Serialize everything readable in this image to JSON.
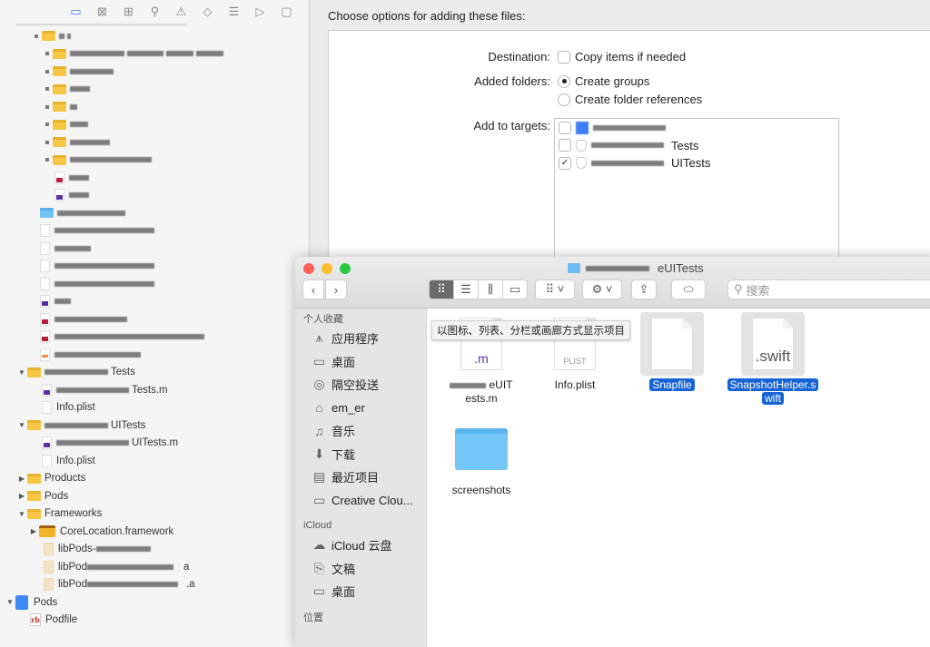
{
  "navigator": {
    "toolbar_icons": [
      "folder-icon",
      "source-control-icon",
      "hierarchy-icon",
      "search-icon",
      "warning-icon",
      "breakpoint-diamond-icon",
      "report-list-icon",
      "tag-icon",
      "comment-icon"
    ],
    "items": [
      {
        "label": "■ ■",
        "kind": "folder",
        "redacted": true
      },
      {
        "label": "",
        "kind": "folder",
        "redacted": true
      },
      {
        "label": "",
        "kind": "folder",
        "redacted": true
      },
      {
        "label": "",
        "kind": "folder",
        "redacted": true
      },
      {
        "label": "",
        "kind": "folder",
        "redacted": true
      },
      {
        "label": "",
        "kind": "folder",
        "redacted": true
      },
      {
        "label": "",
        "kind": "folder",
        "redacted": true
      },
      {
        "label": "",
        "kind": "folder",
        "redacted": true
      },
      {
        "label": "",
        "kind": "file",
        "redacted": true
      },
      {
        "label": "",
        "kind": "file",
        "redacted": true
      },
      {
        "label": "",
        "kind": "folder-blue",
        "redacted": true
      },
      {
        "label": "",
        "kind": "file",
        "redacted": true
      },
      {
        "label": "",
        "kind": "file",
        "redacted": true
      },
      {
        "label": "",
        "kind": "file",
        "redacted": true
      },
      {
        "label": "",
        "kind": "file",
        "redacted": true
      },
      {
        "label": "",
        "kind": "file-m",
        "redacted": true
      },
      {
        "label": "",
        "kind": "file-h",
        "redacted": true
      },
      {
        "label": "",
        "kind": "file-h",
        "redacted": true
      },
      {
        "label": "",
        "kind": "file-swift",
        "redacted": true
      },
      {
        "label": "Tests",
        "kind": "folder"
      },
      {
        "label": "Tests.m",
        "kind": "file-m"
      },
      {
        "label": "Info.plist",
        "kind": "plist"
      },
      {
        "label": "UITests",
        "kind": "folder"
      },
      {
        "label": "UITests.m",
        "kind": "file-m"
      },
      {
        "label": "Info.plist",
        "kind": "plist"
      },
      {
        "label": "Products",
        "kind": "folder"
      },
      {
        "label": "Pods",
        "kind": "folder"
      },
      {
        "label": "Frameworks",
        "kind": "folder"
      },
      {
        "label": "CoreLocation.framework",
        "kind": "framework"
      },
      {
        "label": "libPods-",
        "kind": "lib"
      },
      {
        "label": "libPod",
        "kind": "lib",
        "suffix": "a"
      },
      {
        "label": "libPod",
        "kind": "lib",
        "suffix": ".a"
      },
      {
        "label": "Pods",
        "kind": "project"
      },
      {
        "label": "Podfile",
        "kind": "ruby"
      }
    ]
  },
  "dialog": {
    "title": "Choose options for adding these files:",
    "destination_label": "Destination:",
    "copy_items_label": "Copy items if needed",
    "copy_items_checked": false,
    "added_folders_label": "Added folders:",
    "create_groups_label": "Create groups",
    "create_folder_refs_label": "Create folder references",
    "selected_folder_option": "Create groups",
    "add_to_targets_label": "Add to targets:",
    "targets": [
      {
        "suffix": "",
        "checked": false
      },
      {
        "suffix": "Tests",
        "checked": false
      },
      {
        "suffix": "UITests",
        "checked": true
      }
    ]
  },
  "finder": {
    "window_title_suffix": "eUITests",
    "search_placeholder": "搜索",
    "tooltip": "以图标、列表、分栏或画廊方式显示项目",
    "sidebar": {
      "favorites_header": "个人收藏",
      "favorites": [
        {
          "label": "应用程序",
          "icon": "applications-icon"
        },
        {
          "label": "桌面",
          "icon": "desktop-icon"
        },
        {
          "label": "隔空投送",
          "icon": "airdrop-icon"
        },
        {
          "label": "em_er",
          "icon": "home-icon"
        },
        {
          "label": "音乐",
          "icon": "music-icon"
        },
        {
          "label": "下载",
          "icon": "download-icon"
        },
        {
          "label": "最近项目",
          "icon": "recents-icon"
        },
        {
          "label": "Creative Clou...",
          "icon": "folder-icon"
        }
      ],
      "icloud_header": "iCloud",
      "icloud": [
        {
          "label": "iCloud 云盘",
          "icon": "cloud-icon"
        },
        {
          "label": "文稿",
          "icon": "documents-icon"
        },
        {
          "label": "桌面",
          "icon": "desktop-icon"
        }
      ],
      "locations_header": "位置"
    },
    "files": [
      {
        "name_line1": "eUIT",
        "name_line2": "ests.m",
        "badge": ".m",
        "selected": false
      },
      {
        "name_line1": "Info.plist",
        "badge": "PLIST",
        "selected": false
      },
      {
        "name_line1": "Snapfile",
        "badge": "",
        "selected": true
      },
      {
        "name_line1": "SnapshotHelper.s",
        "name_line2": "wift",
        "badge": ".swift",
        "selected": true
      },
      {
        "name_line1": "screenshots",
        "kind": "folder",
        "selected": false
      }
    ]
  }
}
